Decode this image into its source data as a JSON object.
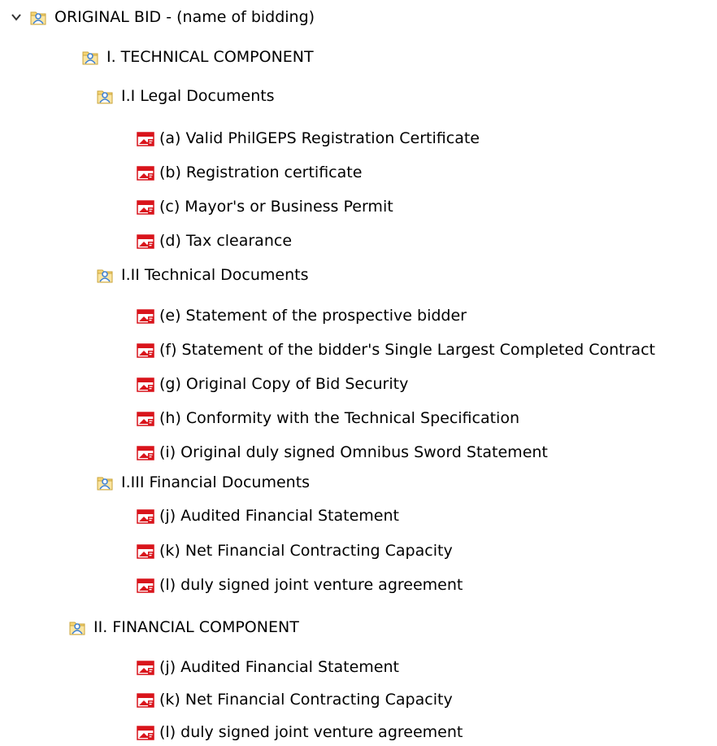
{
  "tree": {
    "root": {
      "label": "ORIGINAL BID - (name of bidding)",
      "expanded": true
    },
    "technical": {
      "label": "I. TECHNICAL COMPONENT",
      "legal": {
        "label": "I.I Legal Documents",
        "files": [
          "(a) Valid PhilGEPS Registration Certificate",
          "(b) Registration certificate",
          "(c) Mayor's or Business Permit",
          "(d) Tax clearance"
        ]
      },
      "tech_docs": {
        "label": "I.II Technical Documents",
        "files": [
          "(e) Statement of the prospective bidder",
          "(f) Statement of the bidder's Single Largest Completed Contract",
          "(g) Original Copy of Bid Security",
          "(h) Conformity with the Technical Specification",
          "(i) Original duly signed Omnibus Sword Statement"
        ]
      },
      "fin_docs": {
        "label": "I.III Financial Documents",
        "files": [
          "(j) Audited Financial Statement",
          "(k) Net Financial Contracting Capacity",
          "(l) duly signed joint venture agreement"
        ]
      }
    },
    "financial": {
      "label": "II. FINANCIAL COMPONENT",
      "files": [
        "(j) Audited Financial Statement",
        "(k) Net Financial Contracting Capacity",
        "(l) duly signed joint venture agreement"
      ]
    }
  },
  "colors": {
    "folder_fill": "#f6d676",
    "folder_user": "#3b7fd4",
    "pdf_red": "#d9141b"
  },
  "icons": {
    "expand": "chevron-down-icon",
    "folder": "shared-folder-icon",
    "file": "pdf-file-icon"
  }
}
